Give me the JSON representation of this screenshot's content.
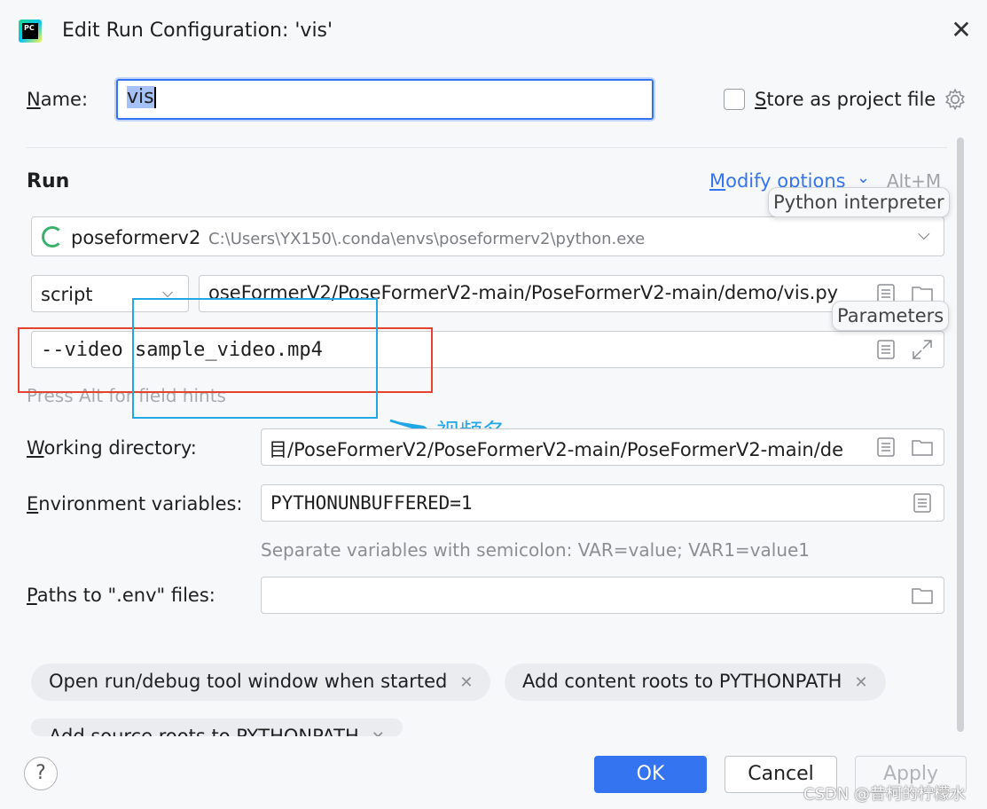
{
  "dialog": {
    "title": "Edit Run Configuration: 'vis'",
    "close_symbol": "✕",
    "app_icon_text": "PC"
  },
  "name_row": {
    "label_u": "N",
    "label_rest": "ame:",
    "value": "vis",
    "store_u": "S",
    "store_rest": "tore as project file"
  },
  "run_section": {
    "title": "Run",
    "modify_u": "M",
    "modify_rest": "odify options",
    "shortcut": "Alt+M",
    "interpreter_name": "poseformerv2",
    "interpreter_path": "C:\\Users\\YX150\\.conda\\envs\\poseformerv2\\python.exe",
    "target_type": "script",
    "script_path": "oseFormerV2/PoseFormerV2-main/PoseFormerV2-main/demo/vis.py",
    "parameters": "--video sample_video.mp4",
    "hint": "Press Alt for field hints",
    "tooltip_interpreter": "Python interpreter",
    "tooltip_parameters": "Parameters"
  },
  "annotation": {
    "label": "视频名",
    "box_colors": {
      "red": "#e5432f",
      "blue": "#21a6e6"
    }
  },
  "fields": {
    "working_dir_u": "W",
    "working_dir_rest": "orking directory:",
    "working_dir_value": "目/PoseFormerV2/PoseFormerV2-main/PoseFormerV2-main/de",
    "env_u": "E",
    "env_rest": "nvironment variables:",
    "env_value": "PYTHONUNBUFFERED=1",
    "env_hint": "Separate variables with semicolon: VAR=value; VAR1=value1",
    "dotenv_u": "P",
    "dotenv_rest": "aths to \".env\" files:",
    "dotenv_value": ""
  },
  "chips": [
    {
      "label": "Open run/debug tool window when started"
    },
    {
      "label": "Add content roots to PYTHONPATH"
    },
    {
      "label": "Add source roots to PYTHONPATH"
    }
  ],
  "footer": {
    "help": "?",
    "ok": "OK",
    "cancel": "Cancel",
    "apply": "Apply",
    "watermark": "CSDN @昔柯的柠檬水"
  },
  "colors": {
    "accent": "#3574f0",
    "background": "#f7f8fa"
  }
}
